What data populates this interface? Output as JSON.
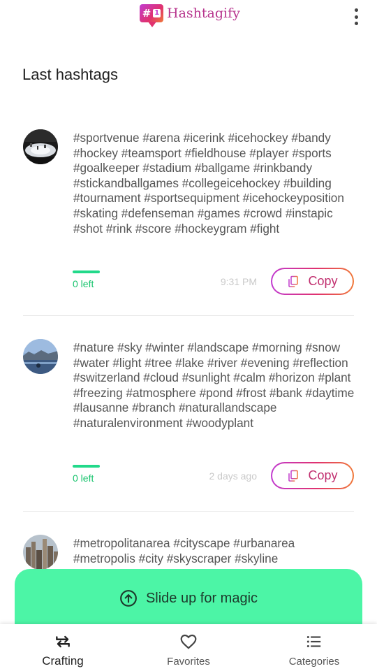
{
  "app": {
    "badge_text": "#",
    "badge_number": "1",
    "title": "Hashtagify",
    "menu_icon": "more-vert-icon"
  },
  "section_title": "Last hashtags",
  "entries": [
    {
      "thumbnail": "hockey-arena-photo",
      "hashtags": "#sportvenue #arena #icerink #icehockey #bandy #hockey #teamsport #fieldhouse #player #sports #goalkeeper #stadium #ballgame #rinkbandy #stickandballgames #collegeicehockey #building #tournament #sportsequipment #icehockeyposition #skating #defenseman #games #crowd #instapic #shot #rink #score #hockeygram #fight",
      "left_label": "0 left",
      "time": "9:31 PM",
      "copy_label": "Copy"
    },
    {
      "thumbnail": "winter-lake-photo",
      "hashtags": "#nature #sky #winter #landscape #morning #snow #water #light #tree #lake #river #evening #reflection #switzerland #cloud #sunlight #calm #horizon #plant #freezing #atmosphere #pond #frost #bank #daytime #lausanne #branch #naturallandscape #naturalenvironment #woodyplant",
      "left_label": "0 left",
      "time": "2 days ago",
      "copy_label": "Copy"
    },
    {
      "thumbnail": "city-skyline-photo",
      "hashtags": "#metropolitanarea #cityscape #urbanarea #metropolis #city #skyscraper #skyline"
    }
  ],
  "slide_panel": {
    "label": "Slide up for magic",
    "icon": "arrow-up-circle-icon"
  },
  "bottom_nav": [
    {
      "label": "Crafting",
      "icon": "swap-arrows-icon",
      "active": true
    },
    {
      "label": "Favorites",
      "icon": "heart-outline-icon",
      "active": false
    },
    {
      "label": "Categories",
      "icon": "list-icon",
      "active": false
    }
  ],
  "colors": {
    "accent_gradient_start": "#c13bd1",
    "accent_gradient_mid": "#e0326f",
    "accent_gradient_end": "#f07a3a",
    "progress_green": "#22d98a",
    "panel_green": "#4cf5a6"
  }
}
